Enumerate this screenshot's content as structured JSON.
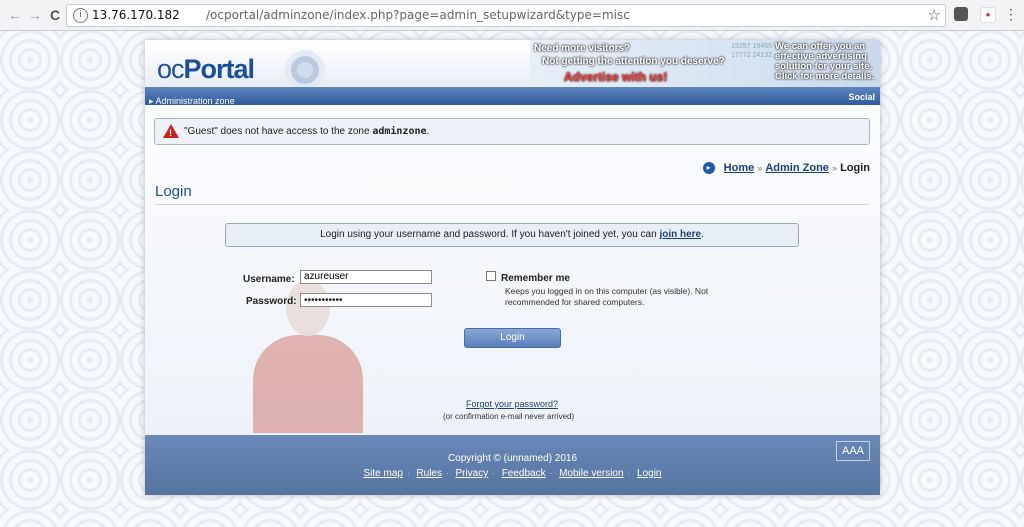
{
  "browser": {
    "back_glyph": "←",
    "forward_glyph": "→",
    "reload_glyph": "C",
    "url_host": "13.76.170.182",
    "url_path": "/ocportal/adminzone/index.php?page=admin_setupwizard&type=misc",
    "info_glyph": "i",
    "star_glyph": "☆",
    "ext2_glyph": "●",
    "menu_glyph": "⋮"
  },
  "header": {
    "logo_oc": "oc",
    "logo_portal": "Portal",
    "ad": {
      "line1": "Need more visitors?",
      "line2": "Not getting the attention you deserve?",
      "line3": "Advertise with us!",
      "stats": "15257 19465 17772 24132",
      "right": "We can offer you an effective advertising solution for your site. Click for more details."
    }
  },
  "bars": {
    "zone": "Administration zone",
    "social": "Social"
  },
  "error": {
    "prefix": "\"Guest\" does not have access to the zone ",
    "zone": "adminzone",
    "suffix": "."
  },
  "breadcrumb": {
    "icon_glyph": "▸",
    "home": "Home",
    "sep": "»",
    "admin": "Admin Zone",
    "current": "Login"
  },
  "page_title": "Login",
  "info": {
    "text": "Login using your username and password. If you haven't joined yet, you can ",
    "link": "join here",
    "suffix": "."
  },
  "form": {
    "username_label": "Username:",
    "username_value": "azureuser",
    "password_label": "Password:",
    "password_value": "•••••••••••",
    "remember_label": "Remember me",
    "remember_desc": "Keeps you logged in on this computer (as visible). Not recommended for shared computers.",
    "login_button": "Login",
    "forgot_link": "Forgot your password?",
    "forgot_note": "(or confirmation e-mail never arrived)"
  },
  "footer": {
    "copyright": "Copyright © (unnamed) 2016",
    "links": [
      "Site map",
      "Rules",
      "Privacy",
      "Feedback",
      "Mobile version",
      "Login"
    ],
    "sep": "·",
    "aaa": "AAA"
  }
}
